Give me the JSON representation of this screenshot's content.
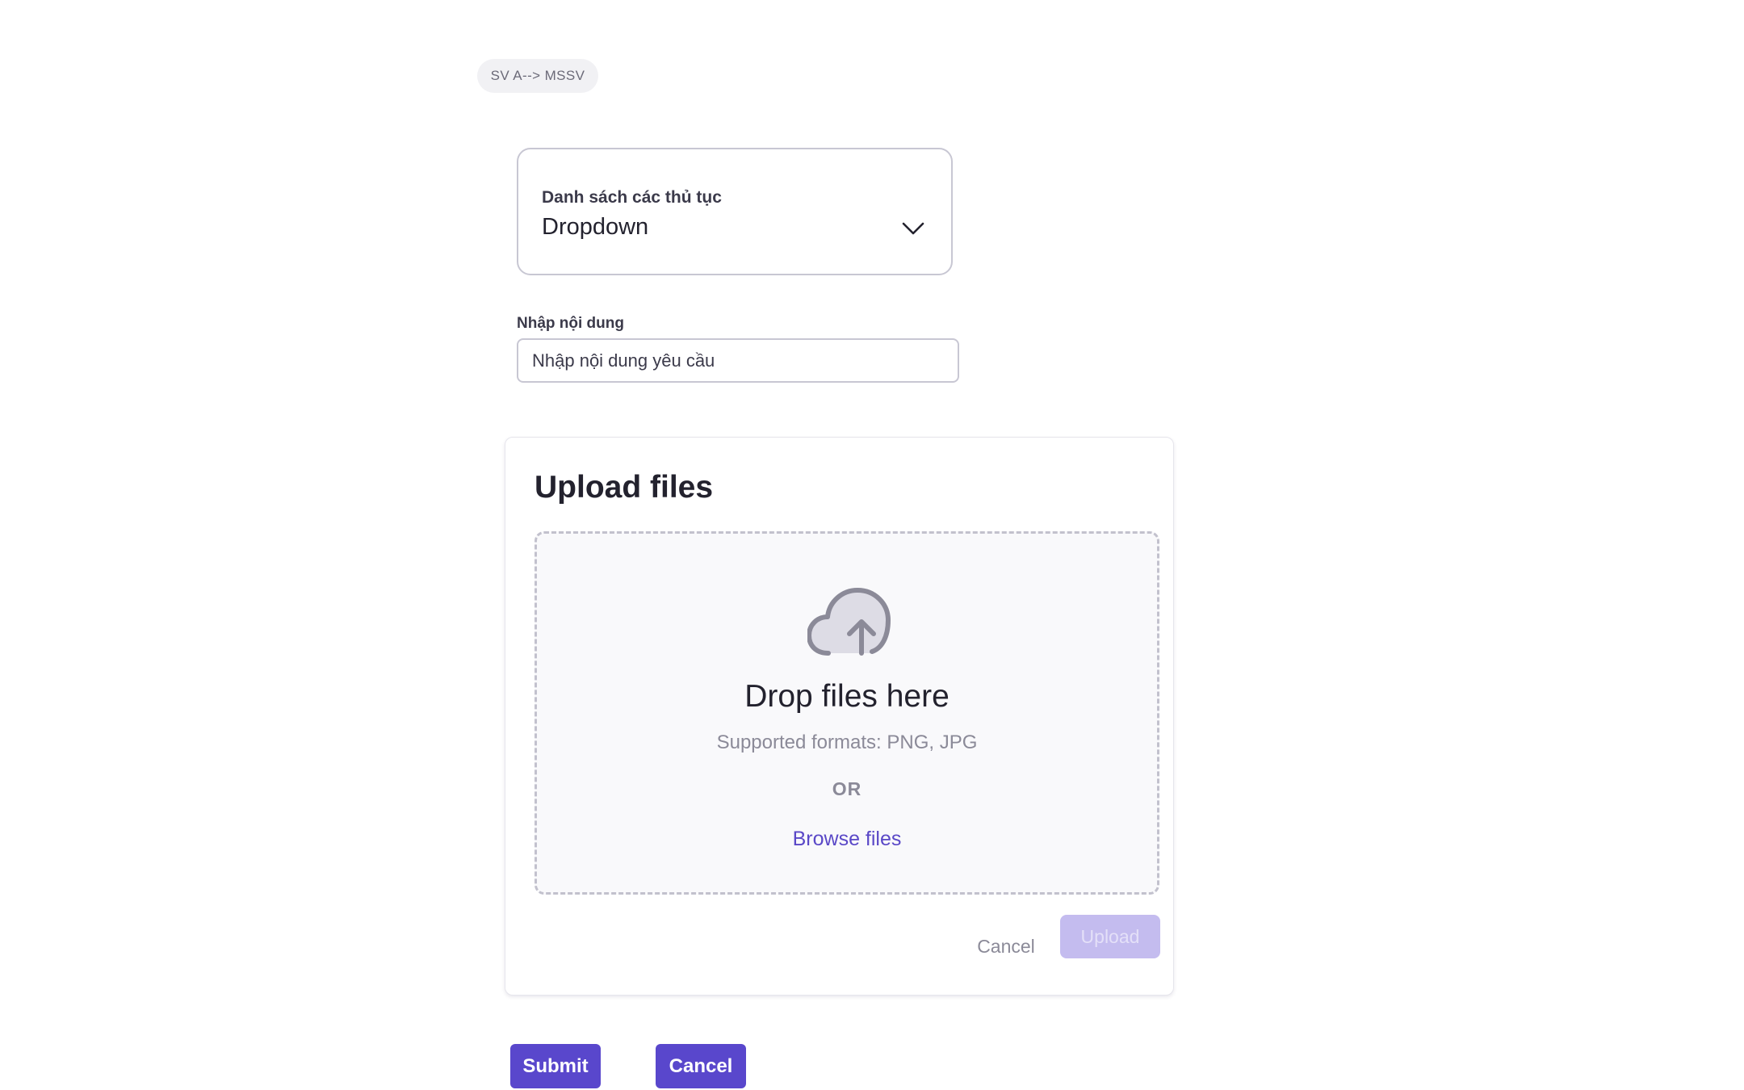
{
  "tag": {
    "label": "SV A--> MSSV"
  },
  "procedure_select": {
    "label": "Danh sách  các thủ tục",
    "value": "Dropdown",
    "icon": "chevron-down-icon"
  },
  "content_field": {
    "label": "Nhập nội dung",
    "placeholder": "Nhập nội dung yêu cầu"
  },
  "upload": {
    "title": "Upload files",
    "icon": "cloud-upload-icon",
    "drop_title": "Drop files here",
    "formats": "Supported formats: PNG, JPG",
    "or": "OR",
    "browse": "Browse files",
    "cancel": "Cancel",
    "upload": "Upload"
  },
  "actions": {
    "submit": "Submit",
    "cancel": "Cancel"
  },
  "colors": {
    "primary": "#5947cc",
    "primary_disabled": "#c4bcef",
    "link": "#5a48c7",
    "muted_text": "#8b8a98",
    "border": "#c8c7d3"
  }
}
